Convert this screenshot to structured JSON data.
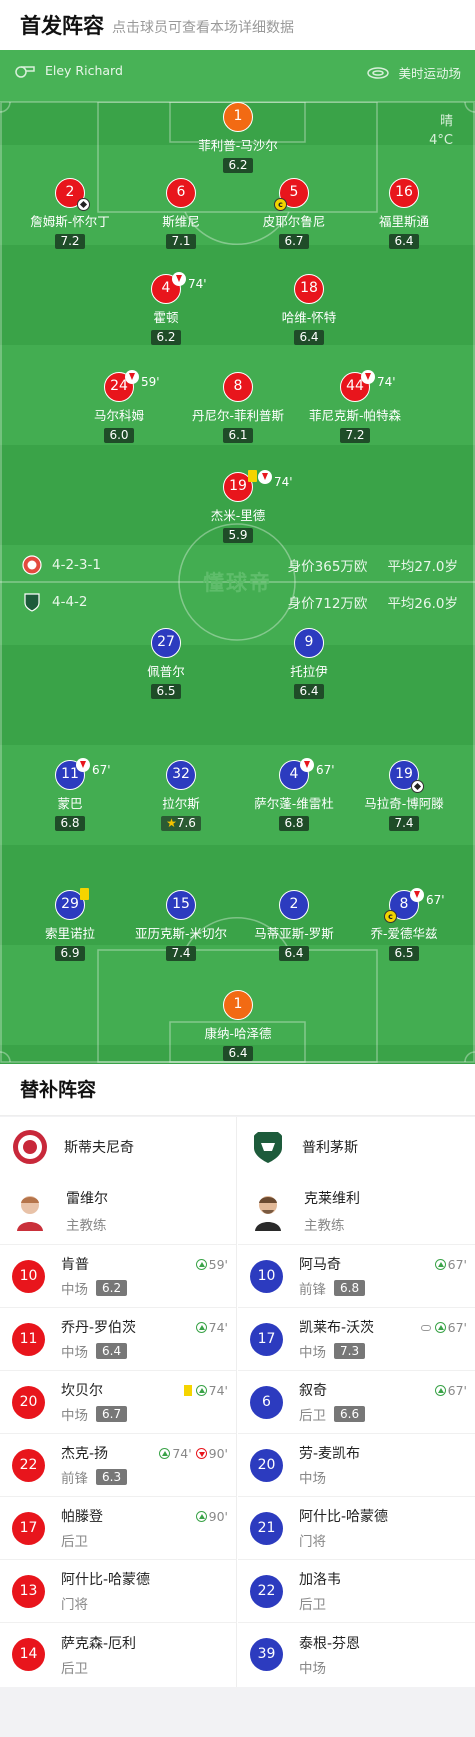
{
  "header": {
    "title": "首发阵容",
    "subtitle": "点击球员可查看本场详细数据"
  },
  "match": {
    "referee": "Eley Richard",
    "venue": "美时运动场",
    "weather": "晴",
    "temperature": "4°C",
    "watermark": "懂球帝"
  },
  "home_formation": {
    "formation": "4-2-3-1",
    "value": "身价365万欧",
    "avg_age": "平均27.0岁"
  },
  "away_formation": {
    "formation": "4-4-2",
    "value": "身价712万欧",
    "avg_age": "平均26.0岁"
  },
  "home_players": [
    {
      "number": "1",
      "name": "菲利普-马沙尔",
      "rating": "6.2"
    },
    {
      "number": "2",
      "name": "詹姆斯-怀尔丁",
      "rating": "7.2"
    },
    {
      "number": "6",
      "name": "斯维尼",
      "rating": "7.1"
    },
    {
      "number": "5",
      "name": "皮耶尔鲁尼",
      "rating": "6.7"
    },
    {
      "number": "16",
      "name": "福里斯通",
      "rating": "6.4"
    },
    {
      "number": "4",
      "name": "霍顿",
      "rating": "6.2",
      "sub_time": "74'"
    },
    {
      "number": "18",
      "name": "哈维-怀特",
      "rating": "6.4"
    },
    {
      "number": "24",
      "name": "马尔科姆",
      "rating": "6.0",
      "sub_time": "59'"
    },
    {
      "number": "8",
      "name": "丹尼尔-菲利普斯",
      "rating": "6.1"
    },
    {
      "number": "44",
      "name": "菲尼克斯-帕特森",
      "rating": "7.2",
      "sub_time": "74'"
    },
    {
      "number": "19",
      "name": "杰米-里德",
      "rating": "5.9",
      "sub_time": "74'"
    }
  ],
  "away_players": [
    {
      "number": "27",
      "name": "佩普尔",
      "rating": "6.5"
    },
    {
      "number": "9",
      "name": "托拉伊",
      "rating": "6.4"
    },
    {
      "number": "11",
      "name": "蒙巴",
      "rating": "6.8",
      "sub_time": "67'"
    },
    {
      "number": "32",
      "name": "拉尔斯",
      "rating": "7.6"
    },
    {
      "number": "4",
      "name": "萨尔蓬-维雷杜",
      "rating": "6.8",
      "sub_time": "67'"
    },
    {
      "number": "19",
      "name": "马拉奇-博阿滕",
      "rating": "7.4"
    },
    {
      "number": "29",
      "name": "索里诺拉",
      "rating": "6.9"
    },
    {
      "number": "15",
      "name": "亚历克斯-米切尔",
      "rating": "7.4"
    },
    {
      "number": "2",
      "name": "马蒂亚斯-罗斯",
      "rating": "6.4"
    },
    {
      "number": "8",
      "name": "乔-爱德华兹",
      "rating": "6.5",
      "sub_time": "67'"
    },
    {
      "number": "1",
      "name": "康纳-哈泽德",
      "rating": "6.4"
    }
  ],
  "subs_title": "替补阵容",
  "home_team": {
    "name": "斯蒂夫尼奇",
    "coach": {
      "name": "雷维尔",
      "role": "主教练"
    },
    "subs": [
      {
        "number": "10",
        "name": "肯普",
        "position": "中场",
        "rating": "6.2",
        "in": "59'"
      },
      {
        "number": "11",
        "name": "乔丹-罗伯茨",
        "position": "中场",
        "rating": "6.4",
        "in": "74'"
      },
      {
        "number": "20",
        "name": "坎贝尔",
        "position": "中场",
        "rating": "6.7",
        "in": "74'"
      },
      {
        "number": "22",
        "name": "杰克-扬",
        "position": "前锋",
        "rating": "6.3",
        "in": "74'",
        "out": "90'"
      },
      {
        "number": "17",
        "name": "帕滕登",
        "position": "后卫",
        "in": "90'"
      },
      {
        "number": "13",
        "name": "阿什比-哈蒙德",
        "position": "门将"
      },
      {
        "number": "14",
        "name": "萨克森-厄利",
        "position": "后卫"
      }
    ]
  },
  "away_team": {
    "name": "普利茅斯",
    "coach": {
      "name": "克莱维利",
      "role": "主教练"
    },
    "subs": [
      {
        "number": "10",
        "name": "阿马奇",
        "position": "前锋",
        "rating": "6.8",
        "in": "67'"
      },
      {
        "number": "17",
        "name": "凯莱布-沃茨",
        "position": "中场",
        "rating": "7.3",
        "in": "67'"
      },
      {
        "number": "6",
        "name": "叙奇",
        "position": "后卫",
        "rating": "6.6",
        "in": "67'"
      },
      {
        "number": "20",
        "name": "劳-麦凯布",
        "position": "中场"
      },
      {
        "number": "21",
        "name": "阿什比-哈蒙德",
        "position": "门将"
      },
      {
        "number": "22",
        "name": "加洛韦",
        "position": "后卫"
      },
      {
        "number": "39",
        "name": "泰根-芬恩",
        "position": "中场"
      }
    ]
  }
}
